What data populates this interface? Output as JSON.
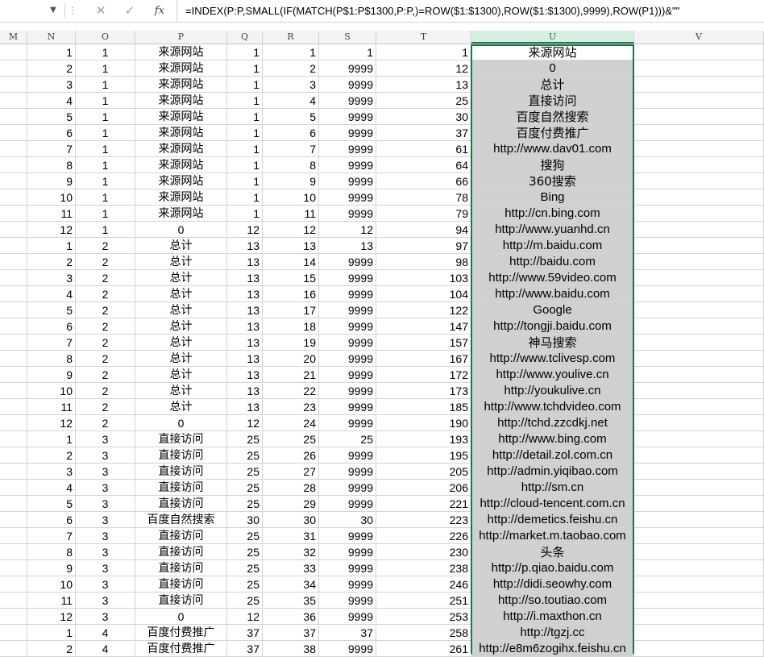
{
  "formula_bar": {
    "fx_label": "fx",
    "formula": "=INDEX(P:P,SMALL(IF(MATCH(P$1:P$1300,P:P,)=ROW($1:$1300),ROW($1:$1300),9999),ROW(P1)))&\"\""
  },
  "columns": [
    "M",
    "N",
    "O",
    "P",
    "Q",
    "R",
    "S",
    "T",
    "U",
    "V"
  ],
  "rows": [
    {
      "N": "1",
      "O": "1",
      "P": "来源网站",
      "Q": "1",
      "R": "1",
      "S": "1",
      "T": "1",
      "U": "来源网站"
    },
    {
      "N": "2",
      "O": "1",
      "P": "来源网站",
      "Q": "1",
      "R": "2",
      "S": "9999",
      "T": "12",
      "U": "0"
    },
    {
      "N": "3",
      "O": "1",
      "P": "来源网站",
      "Q": "1",
      "R": "3",
      "S": "9999",
      "T": "13",
      "U": "总计"
    },
    {
      "N": "4",
      "O": "1",
      "P": "来源网站",
      "Q": "1",
      "R": "4",
      "S": "9999",
      "T": "25",
      "U": "直接访问"
    },
    {
      "N": "5",
      "O": "1",
      "P": "来源网站",
      "Q": "1",
      "R": "5",
      "S": "9999",
      "T": "30",
      "U": "百度自然搜索"
    },
    {
      "N": "6",
      "O": "1",
      "P": "来源网站",
      "Q": "1",
      "R": "6",
      "S": "9999",
      "T": "37",
      "U": "百度付费推广"
    },
    {
      "N": "7",
      "O": "1",
      "P": "来源网站",
      "Q": "1",
      "R": "7",
      "S": "9999",
      "T": "61",
      "U": "http://www.dav01.com"
    },
    {
      "N": "8",
      "O": "1",
      "P": "来源网站",
      "Q": "1",
      "R": "8",
      "S": "9999",
      "T": "64",
      "U": "搜狗"
    },
    {
      "N": "9",
      "O": "1",
      "P": "来源网站",
      "Q": "1",
      "R": "9",
      "S": "9999",
      "T": "66",
      "U": "360搜索"
    },
    {
      "N": "10",
      "O": "1",
      "P": "来源网站",
      "Q": "1",
      "R": "10",
      "S": "9999",
      "T": "78",
      "U": "Bing"
    },
    {
      "N": "11",
      "O": "1",
      "P": "来源网站",
      "Q": "1",
      "R": "11",
      "S": "9999",
      "T": "79",
      "U": "http://cn.bing.com"
    },
    {
      "N": "12",
      "O": "1",
      "P": "0",
      "Q": "12",
      "R": "12",
      "S": "12",
      "T": "94",
      "U": "http://www.yuanhd.cn"
    },
    {
      "N": "1",
      "O": "2",
      "P": "总计",
      "Q": "13",
      "R": "13",
      "S": "13",
      "T": "97",
      "U": "http://m.baidu.com"
    },
    {
      "N": "2",
      "O": "2",
      "P": "总计",
      "Q": "13",
      "R": "14",
      "S": "9999",
      "T": "98",
      "U": "http://baidu.com"
    },
    {
      "N": "3",
      "O": "2",
      "P": "总计",
      "Q": "13",
      "R": "15",
      "S": "9999",
      "T": "103",
      "U": "http://www.59video.com"
    },
    {
      "N": "4",
      "O": "2",
      "P": "总计",
      "Q": "13",
      "R": "16",
      "S": "9999",
      "T": "104",
      "U": "http://www.baidu.com"
    },
    {
      "N": "5",
      "O": "2",
      "P": "总计",
      "Q": "13",
      "R": "17",
      "S": "9999",
      "T": "122",
      "U": "Google"
    },
    {
      "N": "6",
      "O": "2",
      "P": "总计",
      "Q": "13",
      "R": "18",
      "S": "9999",
      "T": "147",
      "U": "http://tongji.baidu.com"
    },
    {
      "N": "7",
      "O": "2",
      "P": "总计",
      "Q": "13",
      "R": "19",
      "S": "9999",
      "T": "157",
      "U": "神马搜索"
    },
    {
      "N": "8",
      "O": "2",
      "P": "总计",
      "Q": "13",
      "R": "20",
      "S": "9999",
      "T": "167",
      "U": "http://www.tclivesp.com"
    },
    {
      "N": "9",
      "O": "2",
      "P": "总计",
      "Q": "13",
      "R": "21",
      "S": "9999",
      "T": "172",
      "U": "http://www.youlive.cn"
    },
    {
      "N": "10",
      "O": "2",
      "P": "总计",
      "Q": "13",
      "R": "22",
      "S": "9999",
      "T": "173",
      "U": "http://youkulive.cn"
    },
    {
      "N": "11",
      "O": "2",
      "P": "总计",
      "Q": "13",
      "R": "23",
      "S": "9999",
      "T": "185",
      "U": "http://www.tchdvideo.com"
    },
    {
      "N": "12",
      "O": "2",
      "P": "0",
      "Q": "12",
      "R": "24",
      "S": "9999",
      "T": "190",
      "U": "http://tchd.zzcdkj.net"
    },
    {
      "N": "1",
      "O": "3",
      "P": "直接访问",
      "Q": "25",
      "R": "25",
      "S": "25",
      "T": "193",
      "U": "http://www.bing.com"
    },
    {
      "N": "2",
      "O": "3",
      "P": "直接访问",
      "Q": "25",
      "R": "26",
      "S": "9999",
      "T": "195",
      "U": "http://detail.zol.com.cn"
    },
    {
      "N": "3",
      "O": "3",
      "P": "直接访问",
      "Q": "25",
      "R": "27",
      "S": "9999",
      "T": "205",
      "U": "http://admin.yiqibao.com"
    },
    {
      "N": "4",
      "O": "3",
      "P": "直接访问",
      "Q": "25",
      "R": "28",
      "S": "9999",
      "T": "206",
      "U": "http://sm.cn"
    },
    {
      "N": "5",
      "O": "3",
      "P": "直接访问",
      "Q": "25",
      "R": "29",
      "S": "9999",
      "T": "221",
      "U": "http://cloud-tencent.com.cn"
    },
    {
      "N": "6",
      "O": "3",
      "P": "百度自然搜索",
      "Q": "30",
      "R": "30",
      "S": "30",
      "T": "223",
      "U": "http://demetics.feishu.cn"
    },
    {
      "N": "7",
      "O": "3",
      "P": "直接访问",
      "Q": "25",
      "R": "31",
      "S": "9999",
      "T": "226",
      "U": "http://market.m.taobao.com"
    },
    {
      "N": "8",
      "O": "3",
      "P": "直接访问",
      "Q": "25",
      "R": "32",
      "S": "9999",
      "T": "230",
      "U": "头条"
    },
    {
      "N": "9",
      "O": "3",
      "P": "直接访问",
      "Q": "25",
      "R": "33",
      "S": "9999",
      "T": "238",
      "U": "http://p.qiao.baidu.com"
    },
    {
      "N": "10",
      "O": "3",
      "P": "直接访问",
      "Q": "25",
      "R": "34",
      "S": "9999",
      "T": "246",
      "U": "http://didi.seowhy.com"
    },
    {
      "N": "11",
      "O": "3",
      "P": "直接访问",
      "Q": "25",
      "R": "35",
      "S": "9999",
      "T": "251",
      "U": "http://so.toutiao.com"
    },
    {
      "N": "12",
      "O": "3",
      "P": "0",
      "Q": "12",
      "R": "36",
      "S": "9999",
      "T": "253",
      "U": "http://i.maxthon.cn"
    },
    {
      "N": "1",
      "O": "4",
      "P": "百度付费推广",
      "Q": "37",
      "R": "37",
      "S": "37",
      "T": "258",
      "U": "http://tgzj.cc"
    },
    {
      "N": "2",
      "O": "4",
      "P": "百度付费推广",
      "Q": "37",
      "R": "38",
      "S": "9999",
      "T": "261",
      "U": "http://e8m6zogihx.feishu.cn"
    }
  ]
}
